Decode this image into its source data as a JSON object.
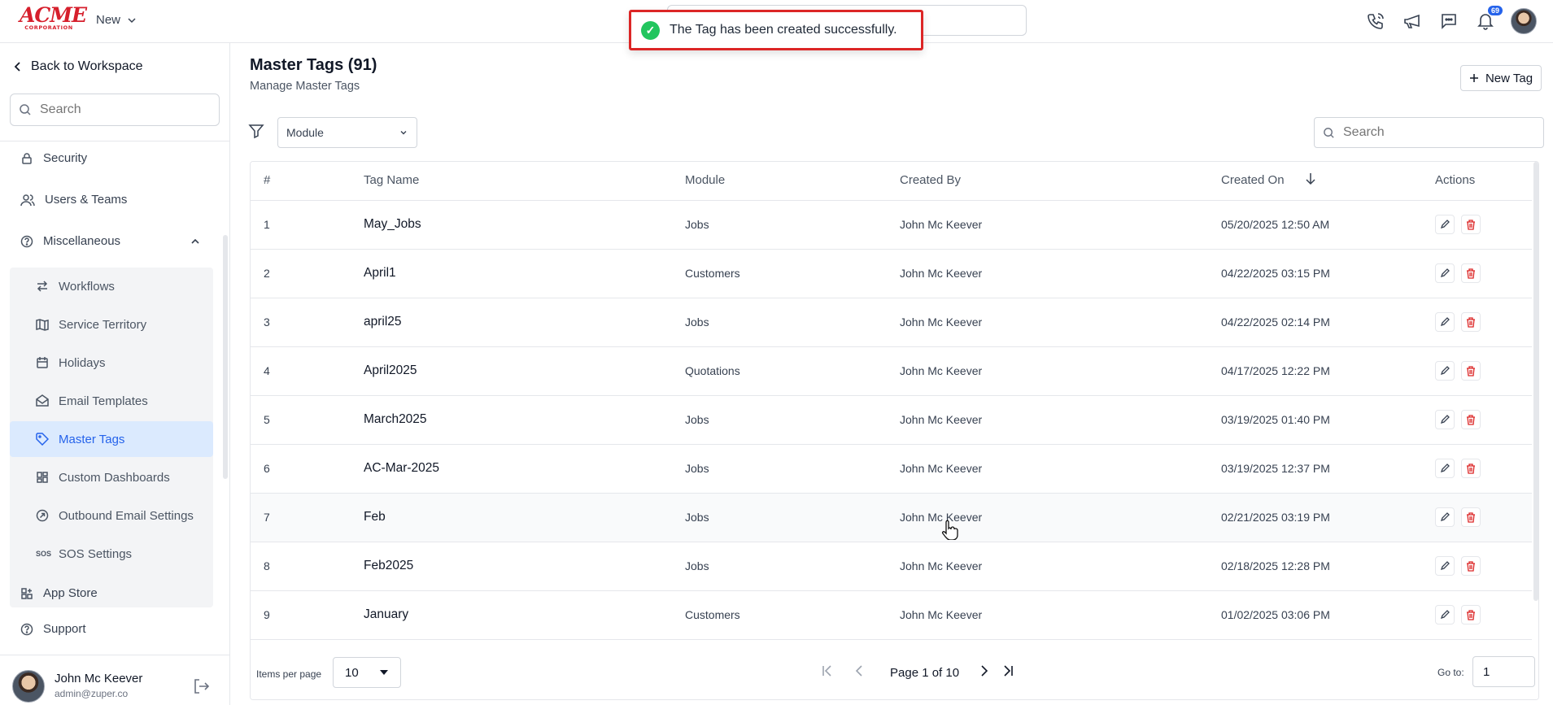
{
  "app": {
    "logo_top": "ACME",
    "logo_bottom": "CORPORATION",
    "new_label": "New",
    "notification_count": "69"
  },
  "toast": {
    "message": "The Tag has been created successfully."
  },
  "sidebar": {
    "back_label": "Back to Workspace",
    "search_placeholder": "Search",
    "items": [
      {
        "label": "Security",
        "icon": "lock-icon"
      },
      {
        "label": "Users & Teams",
        "icon": "users-icon"
      },
      {
        "label": "Miscellaneous",
        "icon": "help-circle-icon"
      }
    ],
    "sub_items": [
      {
        "label": "Workflows",
        "icon": "workflow-icon"
      },
      {
        "label": "Service Territory",
        "icon": "map-icon"
      },
      {
        "label": "Holidays",
        "icon": "calendar-icon"
      },
      {
        "label": "Email Templates",
        "icon": "mail-open-icon"
      },
      {
        "label": "Master Tags",
        "icon": "tag-icon",
        "active": true
      },
      {
        "label": "Custom Dashboards",
        "icon": "dashboard-icon"
      },
      {
        "label": "Outbound Email Settings",
        "icon": "at-icon"
      },
      {
        "label": "SOS Settings",
        "icon": "sos-icon",
        "icon_text": "SOS"
      }
    ],
    "bottom_items": [
      {
        "label": "App Store",
        "icon": "apps-icon"
      },
      {
        "label": "Support",
        "icon": "help-circle-icon"
      }
    ],
    "user": {
      "name": "John Mc Keever",
      "email": "admin@zuper.co"
    }
  },
  "page": {
    "title": "Master Tags (91)",
    "subtitle": "Manage Master Tags",
    "new_tag_label": "New Tag",
    "module_filter": "Module",
    "search_placeholder": "Search"
  },
  "table": {
    "columns": [
      "#",
      "Tag Name",
      "Module",
      "Created By",
      "Created On",
      "Actions"
    ],
    "rows": [
      {
        "num": "1",
        "tag": "May_Jobs",
        "module": "Jobs",
        "created_by": "John Mc Keever",
        "created_on": "05/20/2025 12:50 AM"
      },
      {
        "num": "2",
        "tag": "April1",
        "module": "Customers",
        "created_by": "John Mc Keever",
        "created_on": "04/22/2025 03:15 PM"
      },
      {
        "num": "3",
        "tag": "april25",
        "module": "Jobs",
        "created_by": "John Mc Keever",
        "created_on": "04/22/2025 02:14 PM"
      },
      {
        "num": "4",
        "tag": "April2025",
        "module": "Quotations",
        "created_by": "John Mc Keever",
        "created_on": "04/17/2025 12:22 PM"
      },
      {
        "num": "5",
        "tag": "March2025",
        "module": "Jobs",
        "created_by": "John Mc Keever",
        "created_on": "03/19/2025 01:40 PM"
      },
      {
        "num": "6",
        "tag": "AC-Mar-2025",
        "module": "Jobs",
        "created_by": "John Mc Keever",
        "created_on": "03/19/2025 12:37 PM"
      },
      {
        "num": "7",
        "tag": "Feb",
        "module": "Jobs",
        "created_by": "John Mc Keever",
        "created_on": "02/21/2025 03:19 PM"
      },
      {
        "num": "8",
        "tag": "Feb2025",
        "module": "Jobs",
        "created_by": "John Mc Keever",
        "created_on": "02/18/2025 12:28 PM"
      },
      {
        "num": "9",
        "tag": "January",
        "module": "Customers",
        "created_by": "John Mc Keever",
        "created_on": "01/02/2025 03:06 PM"
      }
    ]
  },
  "pagination": {
    "items_per_page_label": "Items per page",
    "items_per_page": "10",
    "page_info": "Page 1 of 10",
    "goto_label": "Go to:",
    "goto_value": "1"
  }
}
